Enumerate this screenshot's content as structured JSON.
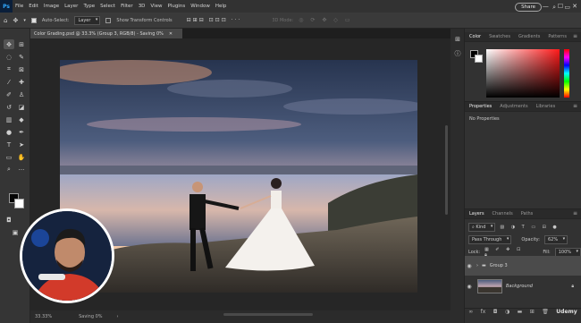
{
  "menubar": {
    "logo": "Ps",
    "items": [
      "File",
      "Edit",
      "Image",
      "Layer",
      "Type",
      "Select",
      "Filter",
      "3D",
      "View",
      "Plugins",
      "Window",
      "Help"
    ],
    "minimize": "—",
    "maximize": "☐",
    "close": "✕"
  },
  "options": {
    "auto_select_label": "Auto-Select:",
    "auto_select_value": "Layer",
    "transform_label": "Show Transform Controls",
    "mode_3d": "3D Mode:",
    "share_label": "Share"
  },
  "document": {
    "tab_title": "Color Grading.psd @ 33.3% (Group 3, RGB/8) - Saving 0%",
    "zoom": "33.33%",
    "status": "Saving 0%"
  },
  "color_panel": {
    "tabs": [
      "Color",
      "Swatches",
      "Gradients",
      "Patterns"
    ],
    "active": "Color",
    "fg": "#000000",
    "bg": "#ffffff"
  },
  "properties_panel": {
    "tabs": [
      "Properties",
      "Adjustments",
      "Libraries"
    ],
    "active": "Properties",
    "message": "No Properties"
  },
  "layers_panel": {
    "tabs": [
      "Layers",
      "Channels",
      "Paths"
    ],
    "active": "Layers",
    "kind_label": "Kind",
    "blend_mode": "Pass Through",
    "opacity_label": "Opacity:",
    "opacity_value": "62%",
    "lock_label": "Lock:",
    "fill_label": "Fill:",
    "fill_value": "100%",
    "layers": [
      {
        "name": "Group 3",
        "type": "group"
      },
      {
        "name": "Background",
        "type": "image"
      }
    ]
  },
  "watermark": "Udemy"
}
